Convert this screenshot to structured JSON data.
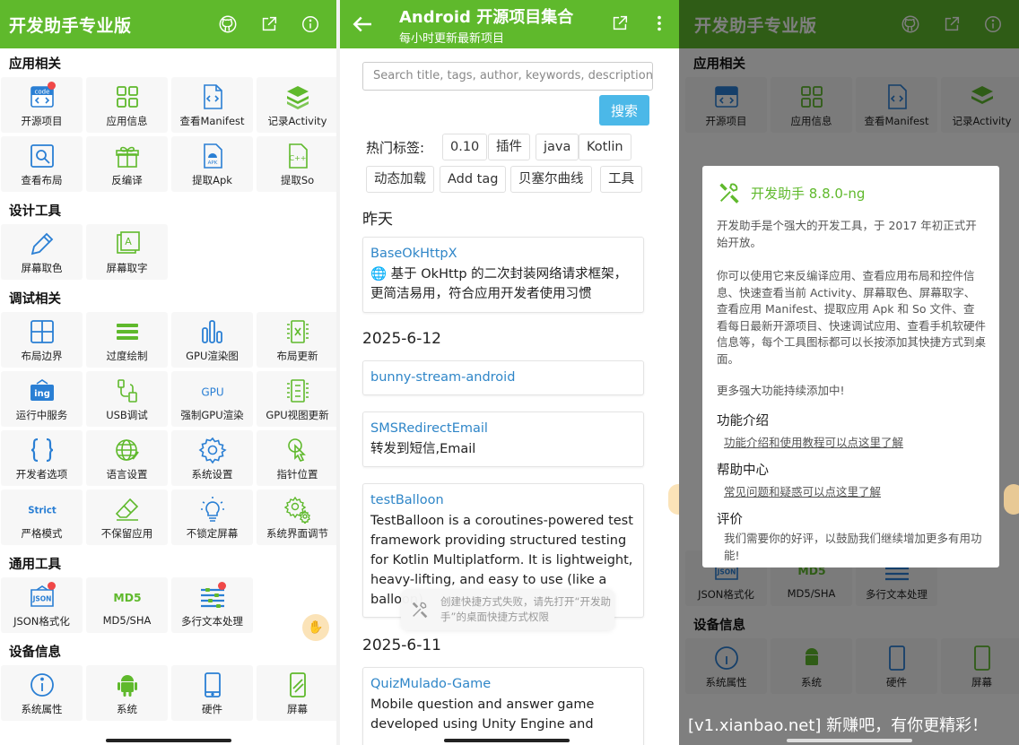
{
  "colors": {
    "accent": "#5fb92c",
    "link": "#2f86c8",
    "search_button": "#4bb8e8",
    "badge": "#f04848"
  },
  "main": {
    "title": "开发助手专业版",
    "actions": [
      "github-icon",
      "share-icon",
      "info-icon"
    ],
    "sections": [
      {
        "title": "应用相关",
        "items": [
          {
            "label": "开源项目",
            "icon": "code-icon",
            "badge": true
          },
          {
            "label": "应用信息",
            "icon": "grid-icon"
          },
          {
            "label": "查看Manifest",
            "icon": "file-code-icon"
          },
          {
            "label": "记录Activity",
            "icon": "layers-icon"
          },
          {
            "label": "查看布局",
            "icon": "search-layout-icon"
          },
          {
            "label": "反编译",
            "icon": "gift-box-icon"
          },
          {
            "label": "提取Apk",
            "icon": "apk-file-icon"
          },
          {
            "label": "提取So",
            "icon": "cpp-file-icon"
          }
        ]
      },
      {
        "title": "设计工具",
        "items": [
          {
            "label": "屏幕取色",
            "icon": "eyedropper-icon"
          },
          {
            "label": "屏幕取字",
            "icon": "text-capture-icon"
          }
        ]
      },
      {
        "title": "调试相关",
        "items": [
          {
            "label": "布局边界",
            "icon": "layout-bounds-icon"
          },
          {
            "label": "过度绘制",
            "icon": "overdraw-icon"
          },
          {
            "label": "GPU渲染图",
            "icon": "bar-chart-icon"
          },
          {
            "label": "布局更新",
            "icon": "layout-update-icon"
          },
          {
            "label": "运行中服务",
            "icon": "running-service-icon"
          },
          {
            "label": "USB调试",
            "icon": "usb-icon"
          },
          {
            "label": "强制GPU渲染",
            "icon": "gpu-icon"
          },
          {
            "label": "GPU视图更新",
            "icon": "gpu-view-icon"
          },
          {
            "label": "开发者选项",
            "icon": "braces-icon"
          },
          {
            "label": "语言设置",
            "icon": "globe-icon"
          },
          {
            "label": "系统设置",
            "icon": "gear-icon"
          },
          {
            "label": "指针位置",
            "icon": "pointer-icon"
          },
          {
            "label": "严格模式",
            "icon": "strict-icon"
          },
          {
            "label": "不保留应用",
            "icon": "eraser-icon"
          },
          {
            "label": "不锁定屏幕",
            "icon": "bulb-icon"
          },
          {
            "label": "系统界面调节",
            "icon": "gears-icon"
          }
        ]
      },
      {
        "title": "通用工具",
        "items": [
          {
            "label": "JSON格式化",
            "icon": "json-icon",
            "badge": true
          },
          {
            "label": "MD5/SHA",
            "icon": "md5-icon"
          },
          {
            "label": "多行文本处理",
            "icon": "multiline-icon",
            "badge": true
          }
        ]
      },
      {
        "title": "设备信息",
        "items": [
          {
            "label": "系统属性",
            "icon": "info-circle-icon"
          },
          {
            "label": "系统",
            "icon": "android-icon"
          },
          {
            "label": "硬件",
            "icon": "phone-icon"
          },
          {
            "label": "屏幕",
            "icon": "screen-icon"
          }
        ]
      }
    ],
    "icon_texts": {
      "code": "code",
      "ing": "ing",
      "gpu": "GPU",
      "strict": "Strict",
      "json": "JSON",
      "md5": "MD5",
      "cpp": "C++",
      "apk": "APK",
      "text_a": "A"
    }
  },
  "projects": {
    "title": "Android 开源项目集合",
    "subtitle": "每小时更新最新项目",
    "search_placeholder": "Search title, tags, author, keywords, description",
    "search_button": "搜索",
    "hot_tags_label": "热门标签:",
    "tags": [
      "0.10",
      "插件",
      "java",
      "Kotlin",
      "动态加载",
      "Add tag",
      "贝塞尔曲线",
      "工具"
    ],
    "groups": [
      {
        "date": "昨天"
      },
      {
        "date": "2025-6-12"
      },
      {
        "date": "2025-6-11"
      }
    ],
    "cards": [
      {
        "title": "BaseOkHttpX",
        "desc": "🌐 基于 OkHttp 的二次封装网络请求框架，更简洁易用，符合应用开发者使用习惯"
      },
      {
        "title": "bunny-stream-android",
        "desc": ""
      },
      {
        "title": "SMSRedirectEmail",
        "desc": "转发到短信,Email"
      },
      {
        "title": "testBalloon",
        "desc": "TestBalloon is a coroutines-powered test framework providing structured testing for Kotlin Multiplatform. It is lightweight, heavy-lifting, and easy to use (like a balloon)"
      },
      {
        "title": "QuizMulado-Game",
        "desc": "Mobile question and answer game developed using Unity Engine and"
      }
    ],
    "toast": "创建快捷方式失败，请先打开“开发助手”的桌面快捷方式权限"
  },
  "dialog": {
    "title": "开发助手 8.8.0-ng",
    "p1": "开发助手是个强大的开发工具，于 2017 年初正式开始开放。",
    "p2": "你可以使用它来反编译应用、查看应用布局和控件信息、快速查看当前 Activity、屏幕取色、屏幕取字、查看应用 Manifest、提取应用 Apk 和 So 文件、查看每日最新开源项目、快速调试应用、查看手机软硬件信息等，每个工具图标都可以长按添加其快捷方式到桌面。",
    "p3": "更多强大功能持续添加中!",
    "s1_title": "功能介绍",
    "s1_link": "功能介绍和使用教程可以点这里了解",
    "s2_title": "帮助中心",
    "s2_link": "常见问题和疑惑可以点这里了解",
    "s3_title": "评价",
    "s3_text": "我们需要你的好评，以鼓励我们继续增加更多有用功能!"
  },
  "watermark": "[v1.xianbao.net] 新赚吧，有你更精彩！"
}
